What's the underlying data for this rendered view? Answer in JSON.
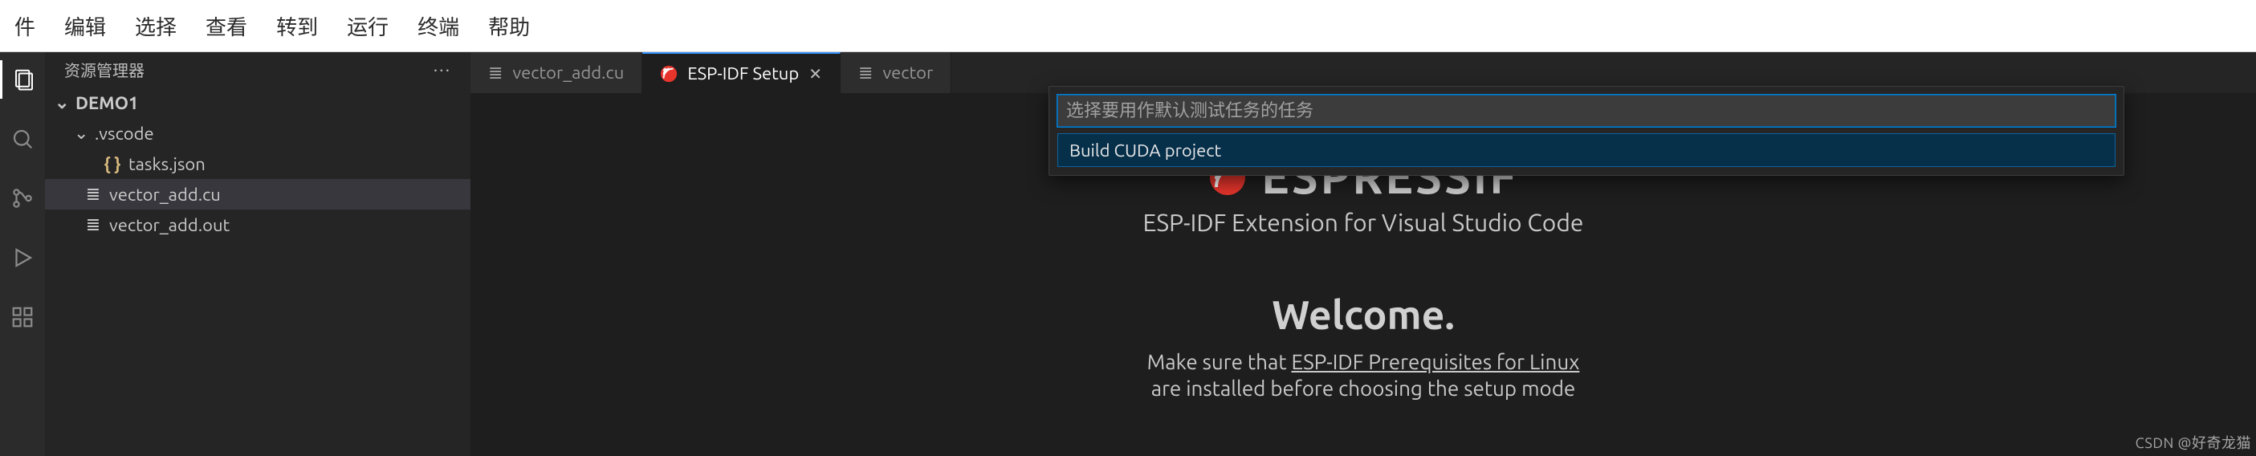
{
  "menu": {
    "items": [
      "件",
      "编辑",
      "选择",
      "查看",
      "转到",
      "运行",
      "终端",
      "帮助"
    ]
  },
  "sidebar": {
    "title": "资源管理器",
    "root": "DEMO1",
    "folder_vscode": ".vscode",
    "file_tasks": "tasks.json",
    "file_vector_cu": "vector_add.cu",
    "file_vector_out": "vector_add.out"
  },
  "tabs": {
    "tab0": {
      "label": "vector_add.cu"
    },
    "tab1": {
      "label": "ESP-IDF Setup"
    },
    "tab2": {
      "label": "vector"
    }
  },
  "quickpick": {
    "placeholder": "选择要用作默认测试任务的任务",
    "value": "",
    "item0": "Build CUDA project"
  },
  "esp": {
    "brand": "ESPRESSIF",
    "subtitle": "ESP-IDF Extension for Visual Studio Code",
    "welcome": "Welcome.",
    "line1_pre": "Make sure that ",
    "line1_link": "ESP-IDF Prerequisites for Linux",
    "line2": "are installed before choosing the setup mode"
  },
  "watermark": "CSDN @好奇龙猫"
}
